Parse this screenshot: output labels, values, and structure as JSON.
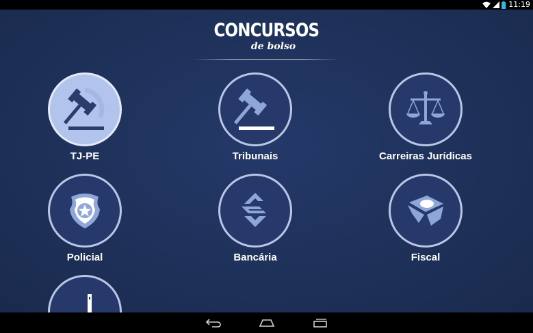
{
  "status": {
    "time": "11:19",
    "icons": [
      "wifi-icon",
      "signal-icon",
      "battery-icon"
    ]
  },
  "header": {
    "title": "CONCURSOS",
    "subtitle": "de bolso"
  },
  "categories": [
    {
      "label": "TJ-PE",
      "icon": "gavel-icon",
      "active": true
    },
    {
      "label": "Tribunais",
      "icon": "gavel-icon",
      "active": false
    },
    {
      "label": "Carreiras Jurídicas",
      "icon": "scales-icon",
      "active": false
    },
    {
      "label": "Policial",
      "icon": "police-badge-icon",
      "active": false
    },
    {
      "label": "Bancária",
      "icon": "bank-logo-icon",
      "active": false
    },
    {
      "label": "Fiscal",
      "icon": "tax-agency-icon",
      "active": false
    }
  ],
  "nav": {
    "buttons": [
      "back-icon",
      "home-icon",
      "recent-apps-icon"
    ]
  },
  "colors": {
    "background": "#1d2f55",
    "circle_border": "#b9c6e6",
    "active_circle": "#b2c3ec",
    "icon": "#8fa6d9"
  }
}
